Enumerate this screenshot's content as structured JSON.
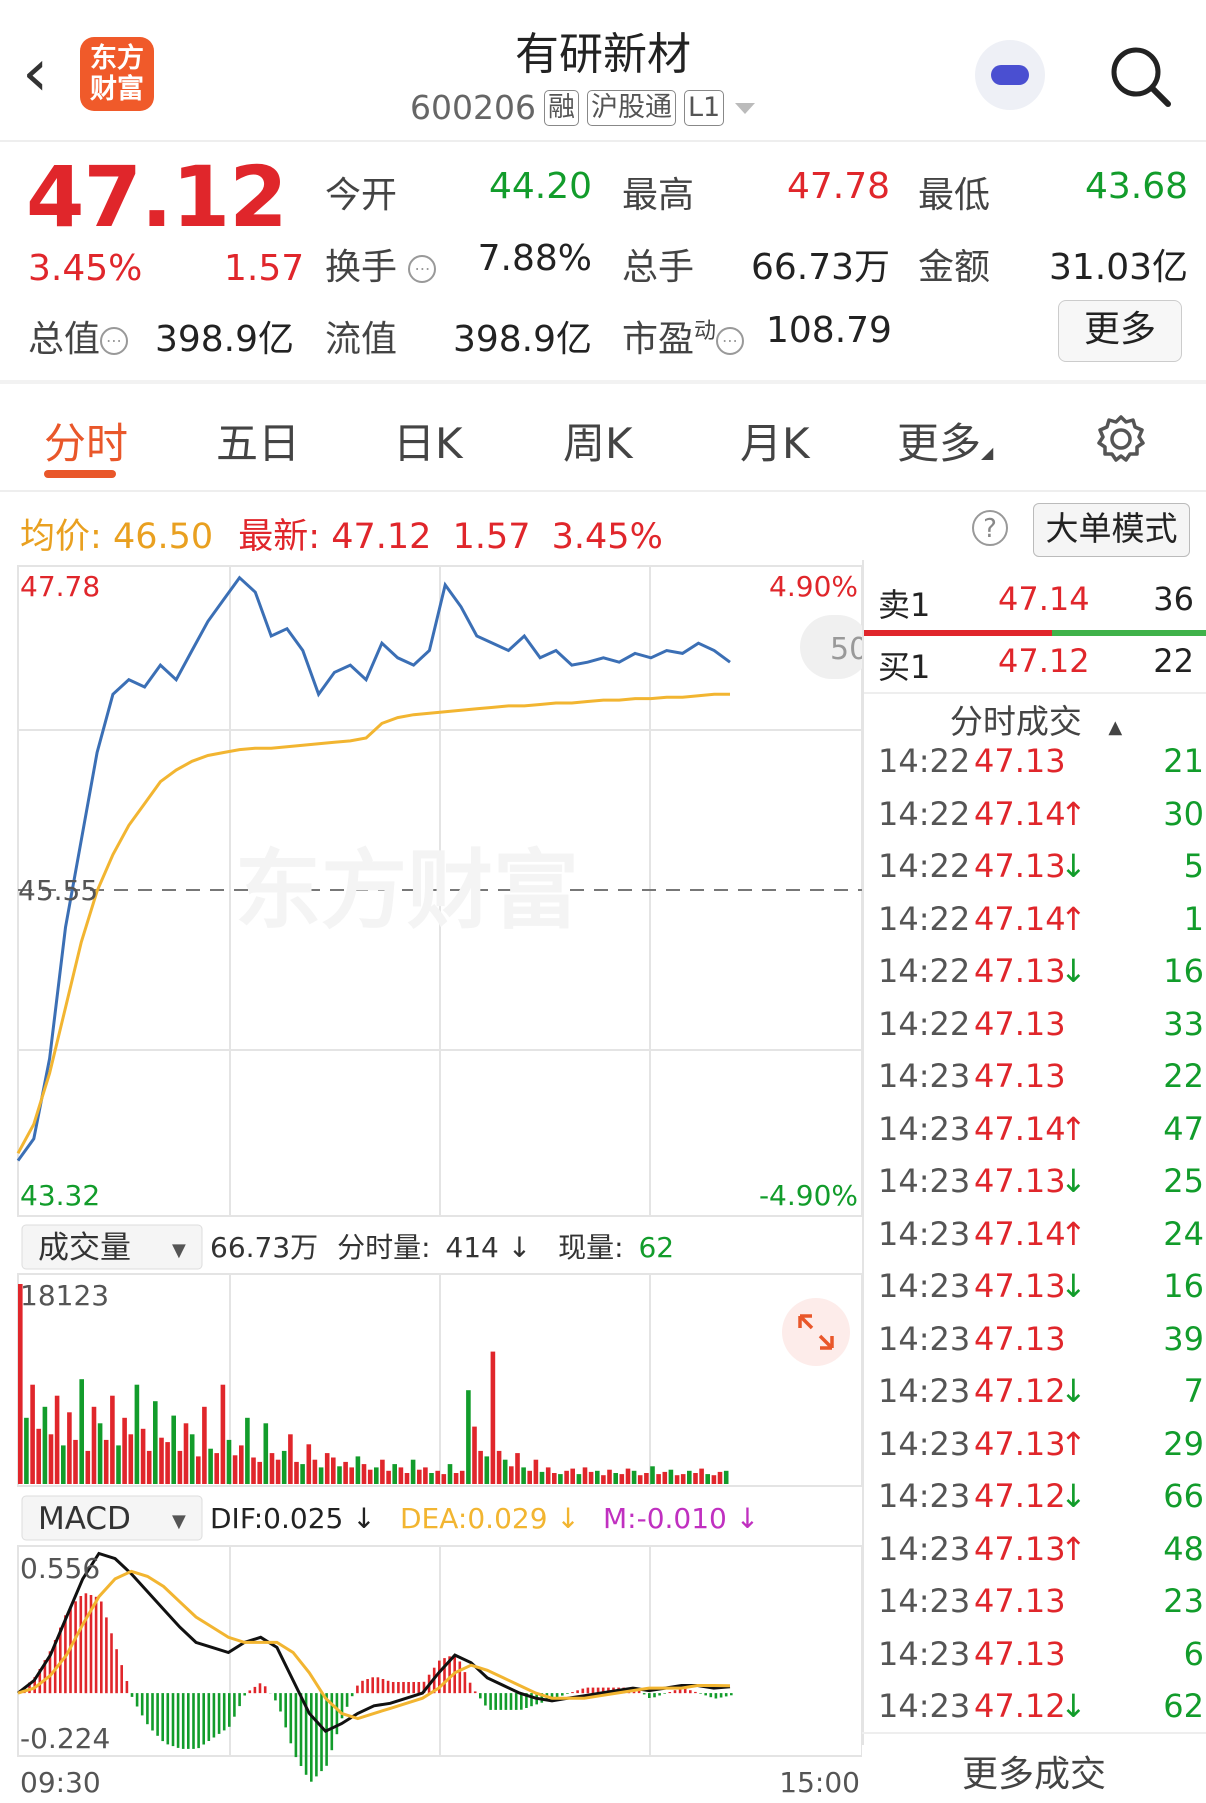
{
  "header": {
    "back_label": "‹",
    "logo_text_line1": "东方",
    "logo_text_line2": "财富",
    "stock_name": "有研新材",
    "stock_code": "600206",
    "tags": [
      "融",
      "沪股通",
      "L1"
    ],
    "icons": [
      "back-icon",
      "robot-avatar-icon",
      "search-icon",
      "dropdown-icon"
    ]
  },
  "quote": {
    "price": "47.12",
    "change_pct": "3.45%",
    "change": "1.57",
    "open_label": "今开",
    "open": "44.20",
    "high_label": "最高",
    "high": "47.78",
    "low_label": "最低",
    "low": "43.68",
    "turnover_label": "换手",
    "turnover": "7.88%",
    "volume_label": "总手",
    "volume": "66.73万",
    "amount_label": "金额",
    "amount": "31.03亿",
    "total_value_label": "总值",
    "total_value": "398.9亿",
    "float_value_label": "流值",
    "float_value": "398.9亿",
    "pe_label": "市盈",
    "pe_sup": "动",
    "pe": "108.79",
    "more_label": "更多"
  },
  "tabs": [
    "分时",
    "五日",
    "日K",
    "周K",
    "月K",
    "更多"
  ],
  "avg_row": {
    "avg_label": "均价:",
    "avg": "46.50",
    "latest_label": "最新:",
    "latest": "47.12",
    "latest_chg": "1.57",
    "latest_pct": "3.45%",
    "help": "?",
    "big_order_label": "大单模式"
  },
  "chart_data": [
    {
      "type": "line",
      "title": "",
      "y_top_label": "47.78",
      "y_bottom_label": "43.32",
      "y_mid_label": "45.55",
      "pct_top_label": "4.90%",
      "pct_bottom_label": "-4.90%",
      "ylim": [
        43.32,
        47.78
      ],
      "x_start_label": "09:30",
      "x_end_label": "15:00",
      "watermark": "东方财富",
      "side_badge": "50",
      "series": [
        {
          "color": "#3b6fb5",
          "values": [
            43.7,
            43.85,
            44.4,
            45.3,
            45.9,
            46.5,
            46.9,
            47.0,
            46.95,
            47.1,
            47.0,
            47.2,
            47.4,
            47.55,
            47.7,
            47.6,
            47.3,
            47.35,
            47.2,
            46.9,
            47.05,
            47.1,
            47.0,
            47.25,
            47.15,
            47.1,
            47.2,
            47.65,
            47.5,
            47.3,
            47.25,
            47.2,
            47.3,
            47.15,
            47.2,
            47.1,
            47.12,
            47.15,
            47.12,
            47.18,
            47.15,
            47.2,
            47.18,
            47.25,
            47.2,
            47.12
          ]
        },
        {
          "color": "#f2b531",
          "values": [
            43.75,
            43.95,
            44.3,
            44.75,
            45.2,
            45.55,
            45.8,
            46.0,
            46.15,
            46.3,
            46.38,
            46.44,
            46.48,
            46.5,
            46.52,
            46.53,
            46.53,
            46.54,
            46.55,
            46.56,
            46.57,
            46.58,
            46.6,
            46.7,
            46.74,
            46.76,
            46.77,
            46.78,
            46.79,
            46.8,
            46.81,
            46.82,
            46.82,
            46.83,
            46.84,
            46.84,
            46.85,
            46.86,
            46.86,
            46.87,
            46.87,
            46.88,
            46.88,
            46.89,
            46.9,
            46.9
          ]
        }
      ]
    },
    {
      "type": "bar",
      "title": "",
      "selector_label": "成交量",
      "summary_volume": "66.73万",
      "tick_label": "分时量:",
      "tick_value": "414 ↓",
      "now_label": "现量:",
      "now_value": "62",
      "y_top_label": "18123",
      "values": [
        18123,
        6000,
        9000,
        5000,
        7000,
        4500,
        8000,
        3500,
        6500,
        4000,
        9500,
        3000,
        7000,
        5500,
        4000,
        8000,
        3500,
        6000,
        4500,
        9000,
        5000,
        3000,
        7500,
        4200,
        3800,
        6200,
        3000,
        5500,
        4500,
        2500,
        7000,
        3200,
        2800,
        9000,
        4000,
        2600,
        3500,
        6000,
        2400,
        2000,
        5500,
        2800,
        2200,
        3000,
        4500,
        2000,
        1800,
        3600,
        2200,
        1500,
        2800,
        2400,
        1600,
        2000,
        1500,
        2500,
        1800,
        1300,
        1500,
        2200,
        1200,
        1800,
        1500,
        1000,
        2200,
        1300,
        1500,
        1000,
        1200,
        900,
        1800,
        1000,
        1200,
        8500,
        5200,
        3000,
        2500,
        12000,
        3000,
        2200,
        1600,
        2800,
        1500,
        1200,
        2200,
        1100,
        1500,
        1000,
        900,
        1200,
        1400,
        900,
        1500,
        1100,
        1200,
        800,
        1300,
        1000,
        900,
        1400,
        1200,
        800,
        1000,
        1600,
        900,
        1100,
        1300,
        800,
        900,
        1200,
        1000,
        1400,
        900,
        800,
        1100,
        1200
      ]
    },
    {
      "type": "bar",
      "title": "",
      "selector_label": "MACD",
      "dif_label": "DIF:0.025 ↓",
      "dea_label": "DEA:0.029 ↓",
      "m_label": "M:-0.010 ↓",
      "y_top_label": "0.556",
      "y_bottom_label": "-0.224",
      "ylim": [
        -0.224,
        0.556
      ],
      "dif": [
        0.0,
        0.05,
        0.15,
        0.3,
        0.45,
        0.55,
        0.53,
        0.47,
        0.4,
        0.33,
        0.26,
        0.2,
        0.18,
        0.16,
        0.2,
        0.22,
        0.18,
        0.05,
        -0.08,
        -0.15,
        -0.12,
        -0.08,
        -0.05,
        -0.04,
        -0.02,
        0.0,
        0.08,
        0.15,
        0.12,
        0.06,
        0.03,
        0.0,
        -0.02,
        -0.03,
        -0.02,
        -0.01,
        0.0,
        0.01,
        0.02,
        0.01,
        0.02,
        0.03,
        0.03,
        0.02,
        0.025
      ],
      "dea": [
        0.0,
        0.02,
        0.07,
        0.15,
        0.27,
        0.38,
        0.45,
        0.48,
        0.46,
        0.42,
        0.36,
        0.3,
        0.26,
        0.22,
        0.2,
        0.2,
        0.2,
        0.16,
        0.08,
        -0.02,
        -0.08,
        -0.1,
        -0.08,
        -0.06,
        -0.04,
        -0.02,
        0.02,
        0.08,
        0.11,
        0.09,
        0.06,
        0.03,
        0.0,
        -0.02,
        -0.02,
        -0.02,
        -0.01,
        0.0,
        0.01,
        0.02,
        0.02,
        0.02,
        0.03,
        0.03,
        0.029
      ]
    }
  ],
  "order_book": {
    "sell_label": "卖1",
    "sell_price": "47.14",
    "sell_vol": "36",
    "buy_label": "买1",
    "buy_price": "47.12",
    "buy_vol": "22",
    "trades_header": "分时成交",
    "trades": [
      {
        "time": "14:22",
        "price": "47.13",
        "dir": "",
        "vol": "21"
      },
      {
        "time": "14:22",
        "price": "47.14",
        "dir": "↑",
        "vol": "30"
      },
      {
        "time": "14:22",
        "price": "47.13",
        "dir": "↓",
        "vol": "5"
      },
      {
        "time": "14:22",
        "price": "47.14",
        "dir": "↑",
        "vol": "1"
      },
      {
        "time": "14:22",
        "price": "47.13",
        "dir": "↓",
        "vol": "16"
      },
      {
        "time": "14:22",
        "price": "47.13",
        "dir": "",
        "vol": "33"
      },
      {
        "time": "14:23",
        "price": "47.13",
        "dir": "",
        "vol": "22"
      },
      {
        "time": "14:23",
        "price": "47.14",
        "dir": "↑",
        "vol": "47"
      },
      {
        "time": "14:23",
        "price": "47.13",
        "dir": "↓",
        "vol": "25"
      },
      {
        "time": "14:23",
        "price": "47.14",
        "dir": "↑",
        "vol": "24"
      },
      {
        "time": "14:23",
        "price": "47.13",
        "dir": "↓",
        "vol": "16"
      },
      {
        "time": "14:23",
        "price": "47.13",
        "dir": "",
        "vol": "39"
      },
      {
        "time": "14:23",
        "price": "47.12",
        "dir": "↓",
        "vol": "7"
      },
      {
        "time": "14:23",
        "price": "47.13",
        "dir": "↑",
        "vol": "29"
      },
      {
        "time": "14:23",
        "price": "47.12",
        "dir": "↓",
        "vol": "66"
      },
      {
        "time": "14:23",
        "price": "47.13",
        "dir": "↑",
        "vol": "48"
      },
      {
        "time": "14:23",
        "price": "47.13",
        "dir": "",
        "vol": "23"
      },
      {
        "time": "14:23",
        "price": "47.13",
        "dir": "",
        "vol": "6"
      },
      {
        "time": "14:23",
        "price": "47.12",
        "dir": "↓",
        "vol": "62"
      }
    ],
    "more_trades_label": "更多成交"
  },
  "colors": {
    "up": "#e0262b",
    "down": "#129c2b",
    "price_line": "#3b6fb5",
    "avg_line": "#f2b531",
    "accent": "#e9572a",
    "dif": "#111111",
    "dea": "#f2b531"
  }
}
